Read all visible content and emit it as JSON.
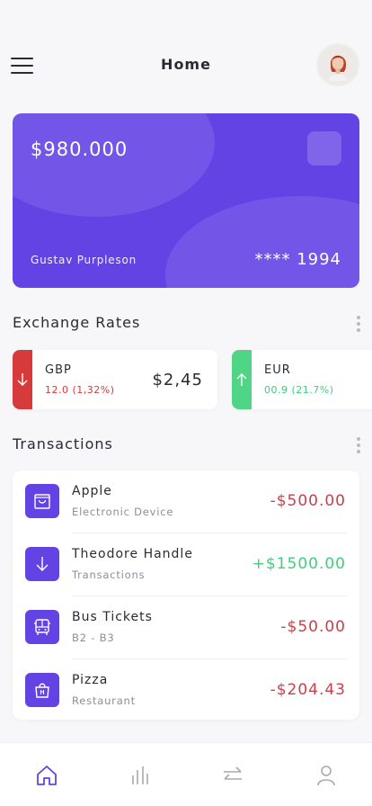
{
  "header": {
    "title": "Home"
  },
  "card": {
    "balance": "$980.000",
    "holder": "Gustav Purpleson",
    "number": "**** 1994"
  },
  "exchange": {
    "title": "Exchange Rates",
    "rates": [
      {
        "code": "GBP",
        "change": "12.0 (1,32%)",
        "amount": "$2,45",
        "direction": "down",
        "color": "#d63a3a"
      },
      {
        "code": "EUR",
        "change": "00.9 (21.7%)",
        "amount": "",
        "direction": "up",
        "color": "#3ecf7a"
      }
    ]
  },
  "transactions": {
    "title": "Transactions",
    "items": [
      {
        "name": "Apple",
        "sub": "Electronic Device",
        "amount": "-$500.00",
        "icon": "shopping-bag-icon"
      },
      {
        "name": "Theodore Handle",
        "sub": "Transactions",
        "amount": "+$1500.00",
        "icon": "arrow-down-icon"
      },
      {
        "name": "Bus Tickets",
        "sub": "B2 - B3",
        "amount": "-$50.00",
        "icon": "bus-icon"
      },
      {
        "name": "Pizza",
        "sub": "Restaurant",
        "amount": "-$204.43",
        "icon": "food-bag-icon"
      }
    ]
  },
  "colors": {
    "accent": "#6443e5",
    "negative": "#c9404a",
    "positive": "#3ecf7a"
  },
  "tabs": [
    {
      "name": "home-icon",
      "active": true
    },
    {
      "name": "stats-icon",
      "active": false
    },
    {
      "name": "transfer-icon",
      "active": false
    },
    {
      "name": "profile-icon",
      "active": false
    }
  ]
}
